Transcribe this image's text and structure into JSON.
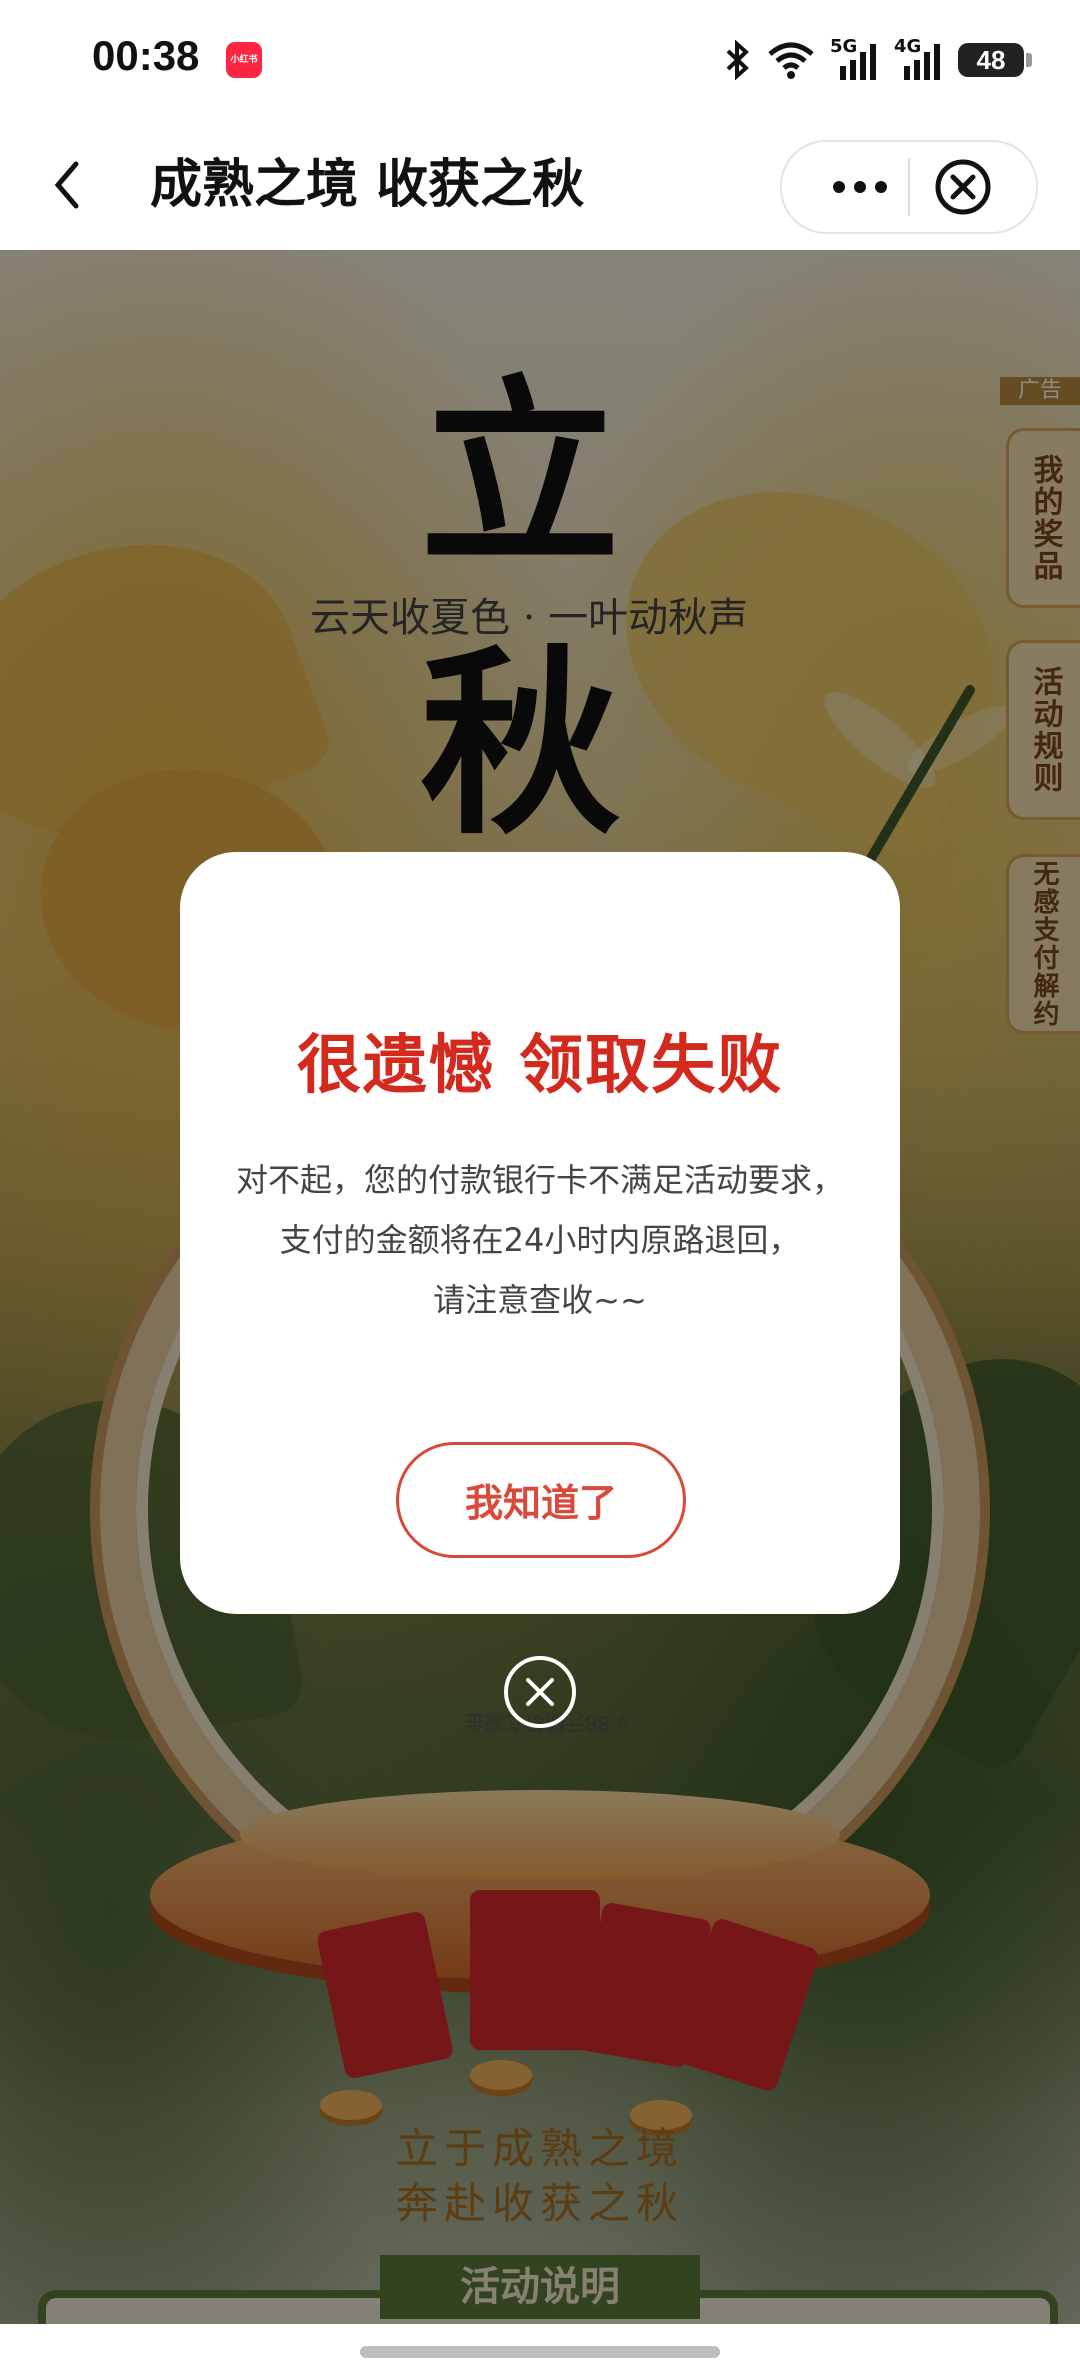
{
  "status_bar": {
    "time": "00:38",
    "app_icon_label": "小红书",
    "network_5g": "5G",
    "network_4g": "4G",
    "battery": "48"
  },
  "nav": {
    "title": "成熟之境 收获之秋"
  },
  "hero": {
    "big_char_1": "立",
    "subtitle": "云天收夏色 · 一叶动秋声",
    "big_char_2": "秋"
  },
  "side": {
    "ad_label": "广告",
    "tab_prizes": "我的奖品",
    "tab_rules": "活动规则",
    "tab_unsign": "无感支付解约"
  },
  "prize_caption": "5.88元随机立减金",
  "slogan": {
    "line1": "立于成熟之境",
    "line2": "奔赴收获之秋"
  },
  "rules_title": "活动说明",
  "modal": {
    "title": "很遗憾 领取失败",
    "line1": "对不起，您的付款银行卡不满足活动要求，",
    "line2": "支付的金额将在24小时内原路退回，",
    "line3": "请注意查收~~",
    "confirm_label": "我知道了"
  }
}
